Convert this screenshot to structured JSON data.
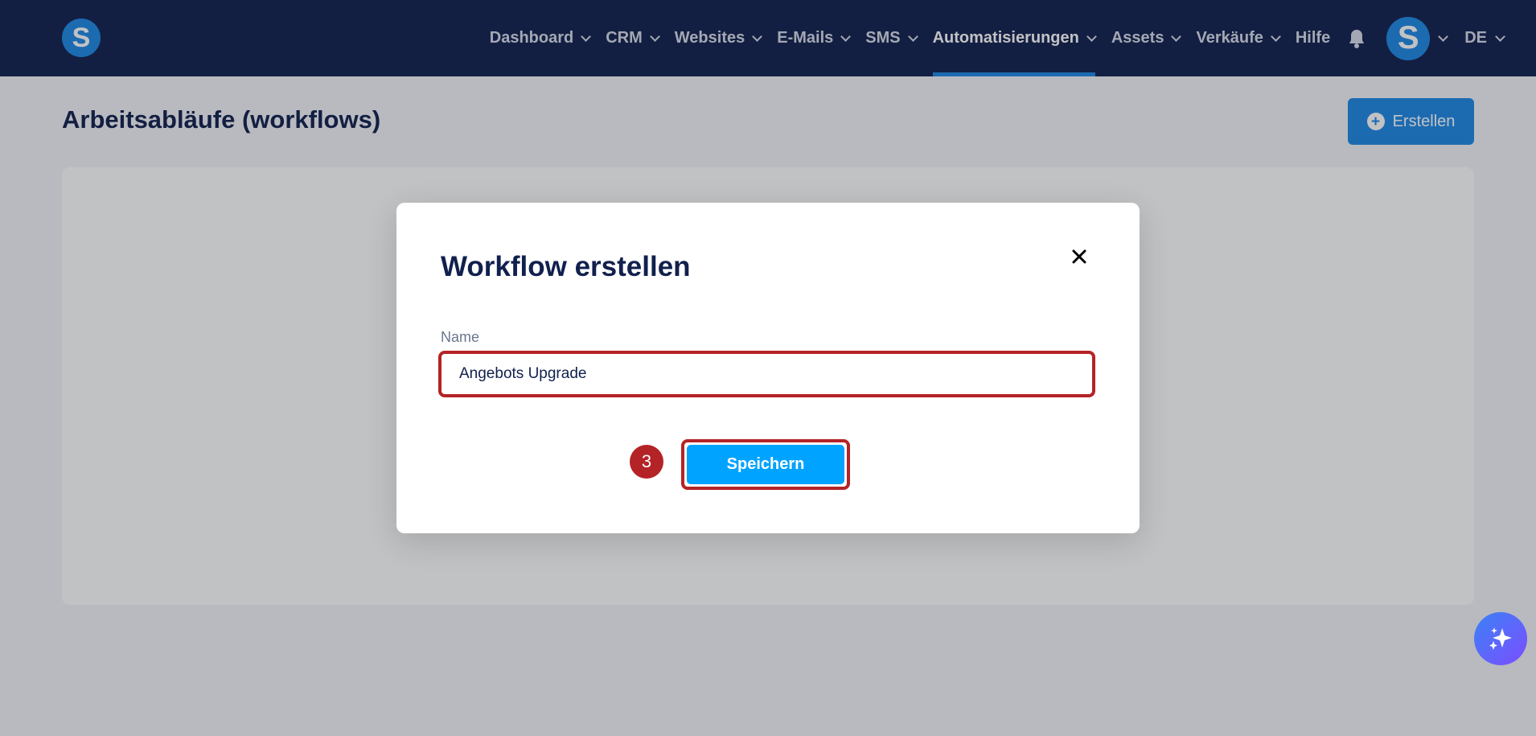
{
  "app": {
    "logo_letter": "S",
    "brand_color": "#1e88e5"
  },
  "nav": {
    "items": [
      {
        "label": "Dashboard",
        "dropdown": true,
        "active": false
      },
      {
        "label": "CRM",
        "dropdown": true,
        "active": false
      },
      {
        "label": "Websites",
        "dropdown": true,
        "active": false
      },
      {
        "label": "E-Mails",
        "dropdown": true,
        "active": false
      },
      {
        "label": "SMS",
        "dropdown": true,
        "active": false
      },
      {
        "label": "Automatisierungen",
        "dropdown": true,
        "active": true
      },
      {
        "label": "Assets",
        "dropdown": true,
        "active": false
      },
      {
        "label": "Verkäufe",
        "dropdown": true,
        "active": false
      },
      {
        "label": "Hilfe",
        "dropdown": false,
        "active": false
      }
    ],
    "bell_icon": "bell-icon",
    "avatar_letter": "S",
    "language": "DE"
  },
  "page": {
    "title": "Arbeitsabläufe (workflows)",
    "create_button_label": "Erstellen"
  },
  "modal": {
    "title": "Workflow erstellen",
    "name_label": "Name",
    "name_value": "Angebots Upgrade",
    "step_badge": "3",
    "save_label": "Speichern",
    "highlight_color": "#b42326",
    "save_color": "#00a3ff"
  }
}
